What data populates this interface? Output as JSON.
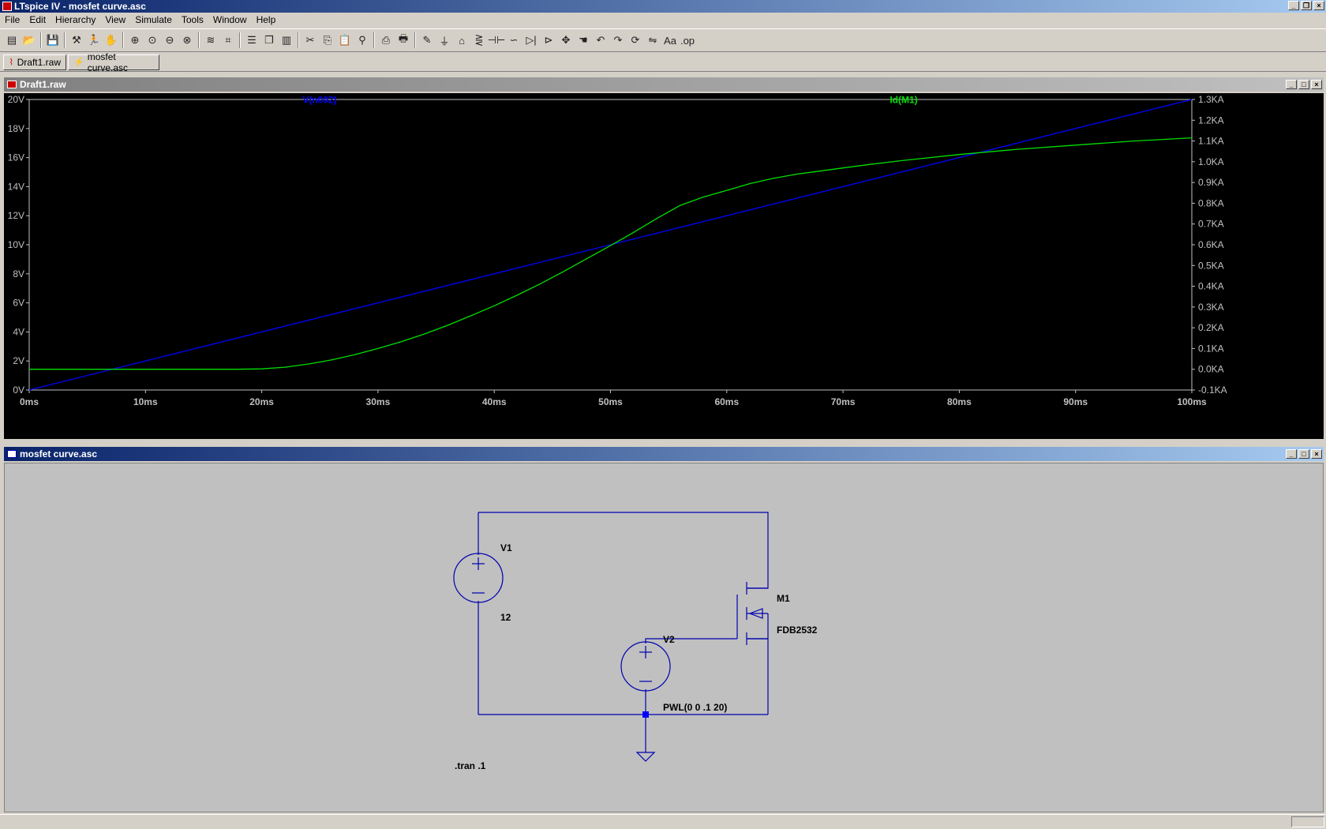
{
  "window": {
    "title": "LTspice IV - mosfet curve.asc"
  },
  "menu": [
    "File",
    "Edit",
    "Hierarchy",
    "View",
    "Simulate",
    "Tools",
    "Window",
    "Help"
  ],
  "toolbar_icons": [
    "new-schematic-icon",
    "open-icon",
    "|",
    "save-icon",
    "|",
    "control-panel-icon",
    "run-icon",
    "halt-icon",
    "|",
    "zoom-in-icon",
    "zoom-back-icon",
    "zoom-out-icon",
    "zoom-fit-icon",
    "|",
    "autorange-icon",
    "mark-icon",
    "|",
    "tile-horizontal-icon",
    "cascade-icon",
    "tile-vertical-icon",
    "|",
    "cut-icon",
    "copy-icon",
    "paste-icon",
    "find-icon",
    "|",
    "print-setup-icon",
    "print-icon",
    "|",
    "draw-wire-icon",
    "ground-icon",
    "label-net-icon",
    "resistor-icon",
    "capacitor-icon",
    "inductor-icon",
    "diode-icon",
    "component-icon",
    "move-icon",
    "drag-icon",
    "undo-icon",
    "redo-icon",
    "rotate-icon",
    "mirror-icon",
    "text-icon",
    "spice-directive-icon"
  ],
  "tabs": [
    {
      "label": "Draft1.raw",
      "icon": "waveform-icon"
    },
    {
      "label": "mosfet curve.asc",
      "icon": "schematic-icon"
    }
  ],
  "plot_window": {
    "title": "Draft1.raw"
  },
  "schematic_window": {
    "title": "mosfet curve.asc"
  },
  "colors": {
    "trace1": "#0000ff",
    "trace2": "#00e000",
    "plot_bg": "#000000",
    "axis": "#c0c0c0"
  },
  "chart_data": {
    "type": "line",
    "x_ticks": [
      "0ms",
      "10ms",
      "20ms",
      "30ms",
      "40ms",
      "50ms",
      "60ms",
      "70ms",
      "80ms",
      "90ms",
      "100ms"
    ],
    "xlim": [
      0,
      100
    ],
    "y_left_ticks": [
      "0V",
      "2V",
      "4V",
      "6V",
      "8V",
      "10V",
      "12V",
      "14V",
      "16V",
      "18V",
      "20V"
    ],
    "ylim_left": [
      0,
      20
    ],
    "y_right_ticks": [
      "-0.1KA",
      "0.0KA",
      "0.1KA",
      "0.2KA",
      "0.3KA",
      "0.4KA",
      "0.5KA",
      "0.6KA",
      "0.7KA",
      "0.8KA",
      "0.9KA",
      "1.0KA",
      "1.1KA",
      "1.2KA",
      "1.3KA"
    ],
    "ylim_right": [
      -0.1,
      1.3
    ],
    "series": [
      {
        "name": "V(n002)",
        "axis": "left",
        "x": [
          0,
          100
        ],
        "y": [
          0,
          20
        ]
      },
      {
        "name": "Id(M1)",
        "axis": "right",
        "x": [
          0,
          5,
          10,
          15,
          18,
          20,
          22,
          24,
          26,
          28,
          30,
          32,
          34,
          36,
          38,
          40,
          42,
          44,
          46,
          48,
          50,
          52,
          54,
          56,
          58,
          60,
          62,
          64,
          66,
          68,
          70,
          72,
          75,
          80,
          85,
          90,
          95,
          100
        ],
        "y": [
          0.0,
          0.0,
          0.0,
          0.0,
          0.0,
          0.002,
          0.01,
          0.025,
          0.045,
          0.07,
          0.1,
          0.133,
          0.17,
          0.212,
          0.258,
          0.306,
          0.358,
          0.413,
          0.472,
          0.534,
          0.596,
          0.66,
          0.727,
          0.79,
          0.83,
          0.862,
          0.895,
          0.92,
          0.94,
          0.955,
          0.97,
          0.985,
          1.005,
          1.035,
          1.06,
          1.08,
          1.1,
          1.115
        ]
      }
    ],
    "grid": false,
    "legend": "top"
  },
  "schematic": {
    "v1_name": "V1",
    "v1_value": "12",
    "v2_name": "V2",
    "v2_value": "PWL(0 0 .1 20)",
    "m1_name": "M1",
    "m1_model": "FDB2532",
    "directive": ".tran .1"
  }
}
